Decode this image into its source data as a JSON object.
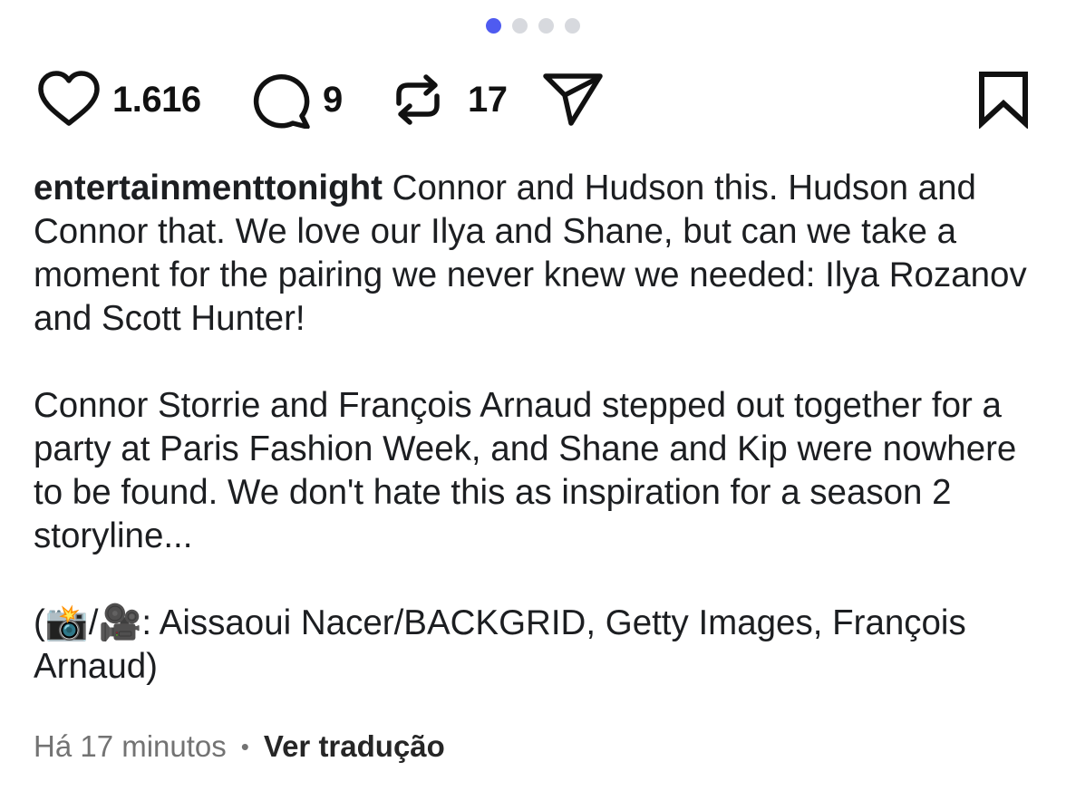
{
  "carousel": {
    "total_dots": 4,
    "active_index": 0,
    "active_color": "#4f5bf0",
    "inactive_color": "#d7d9de"
  },
  "actions": {
    "like": {
      "icon": "heart-icon",
      "count": "1.616"
    },
    "comment": {
      "icon": "comment-bubble-icon",
      "count": "9"
    },
    "repost": {
      "icon": "repost-icon",
      "count": "17"
    },
    "share": {
      "icon": "paper-plane-icon"
    },
    "save": {
      "icon": "bookmark-icon"
    }
  },
  "caption": {
    "username": "entertainmenttonight",
    "paragraph1": " Connor and Hudson this. Hudson and Connor that. We love our Ilya and Shane, but can we take a moment for the pairing we never knew we needed: Ilya Rozanov and Scott Hunter!",
    "paragraph2": "Connor Storrie and François Arnaud stepped out together for a party at Paris Fashion Week, and Shane and Kip were nowhere to be found. We don't hate this as inspiration for a season 2 storyline...",
    "paragraph3": "(📸/🎥: Aissaoui Nacer/BACKGRID, Getty Images, François Arnaud)"
  },
  "meta": {
    "timestamp": "Há 17 minutos",
    "separator": "•",
    "translate_label": "Ver tradução"
  }
}
